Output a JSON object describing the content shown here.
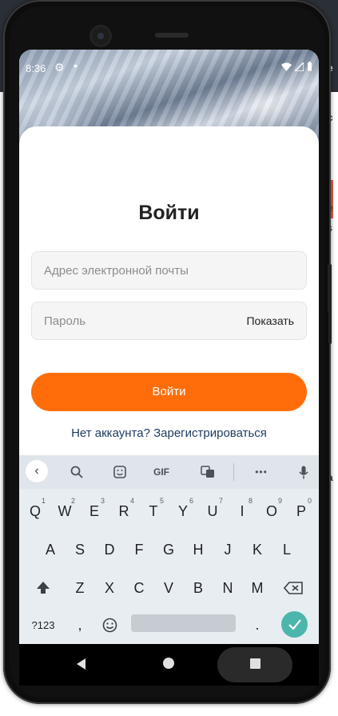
{
  "status_bar": {
    "time": "8:36",
    "icons": [
      "gear-icon",
      "dot-icon",
      "wifi-icon",
      "signal-icon",
      "battery-icon"
    ]
  },
  "login": {
    "title": "Войти",
    "email_placeholder": "Адрес электронной почты",
    "password_placeholder": "Пароль",
    "show_password_label": "Показать",
    "submit_label": "Войти",
    "register_link": "Нет аккаунта? Зарегистрироваться"
  },
  "colors": {
    "accent": "#ff6d0a",
    "link": "#1e3a5f",
    "keyboard_enter": "#4db6ac"
  },
  "keyboard": {
    "toolbar": {
      "gif_label": "GIF",
      "more_label": "•••"
    },
    "row1": [
      {
        "key": "Q",
        "hint": "1"
      },
      {
        "key": "W",
        "hint": "2"
      },
      {
        "key": "E",
        "hint": "3"
      },
      {
        "key": "R",
        "hint": "4"
      },
      {
        "key": "T",
        "hint": "5"
      },
      {
        "key": "Y",
        "hint": "6"
      },
      {
        "key": "U",
        "hint": "7"
      },
      {
        "key": "I",
        "hint": "8"
      },
      {
        "key": "O",
        "hint": "9"
      },
      {
        "key": "P",
        "hint": "0"
      }
    ],
    "row2": [
      "A",
      "S",
      "D",
      "F",
      "G",
      "H",
      "J",
      "K",
      "L"
    ],
    "row3": [
      "Z",
      "X",
      "C",
      "V",
      "B",
      "N",
      "M"
    ],
    "row4": {
      "symbols_label": "?123",
      "comma": ",",
      "period": "."
    }
  },
  "background": {
    "partial_text": [
      "e",
      "c",
      "e",
      "s",
      "e",
      "a"
    ]
  }
}
